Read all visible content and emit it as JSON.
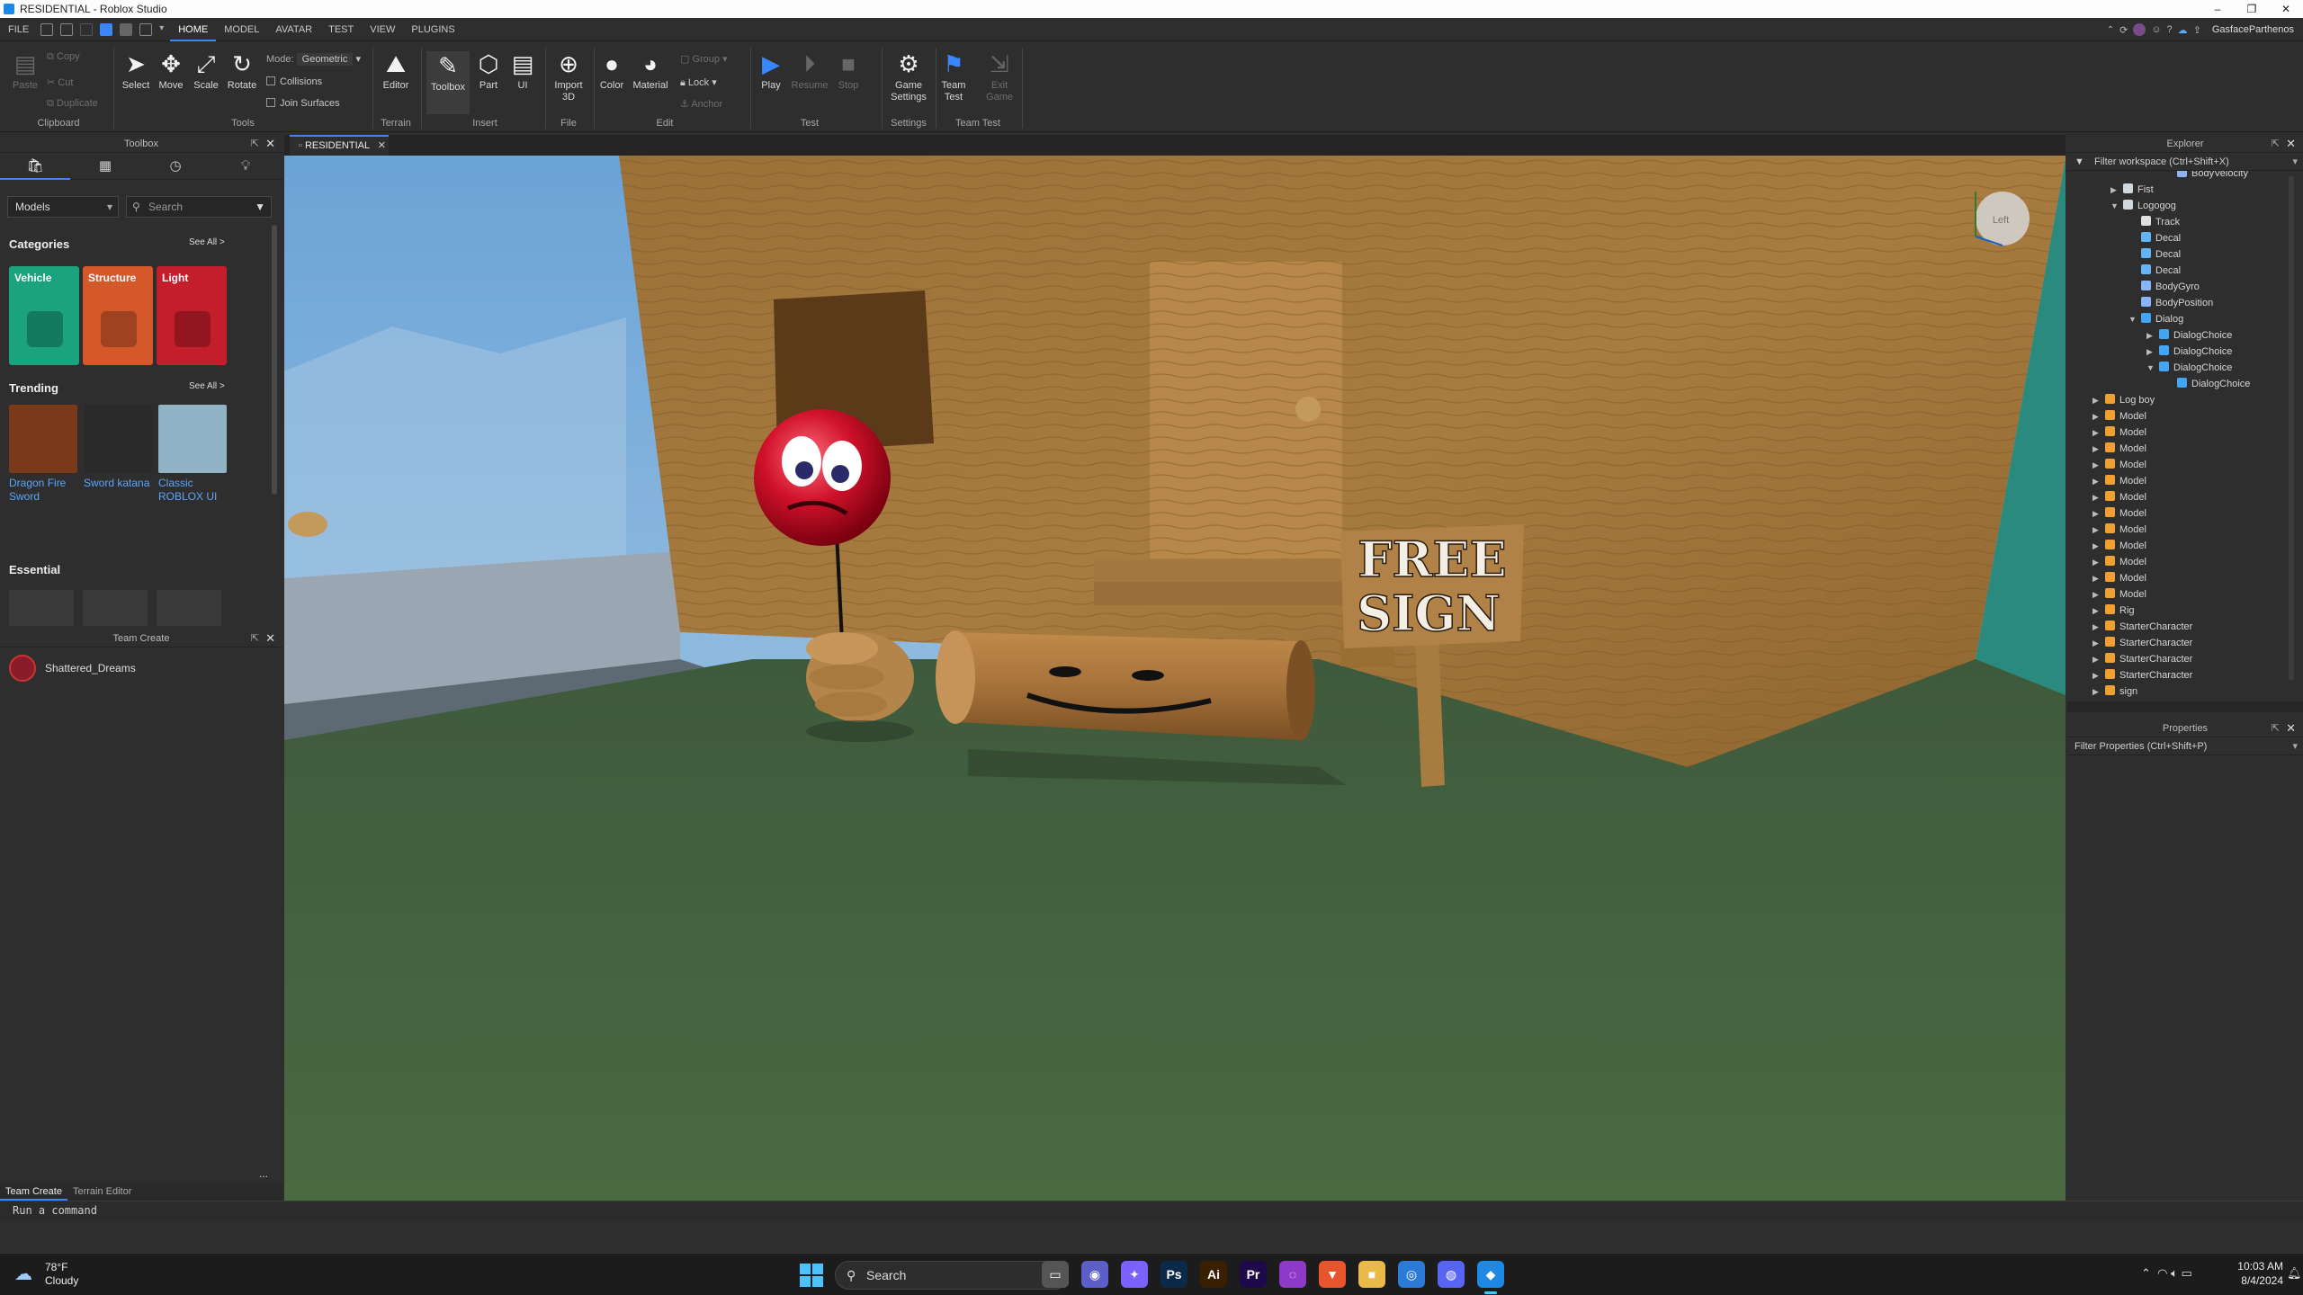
{
  "window": {
    "title": "RESIDENTIAL - Roblox Studio",
    "minimize": "–",
    "maximize": "❐",
    "close": "✕"
  },
  "menu": {
    "items": [
      "FILE",
      "HOME",
      "MODEL",
      "AVATAR",
      "TEST",
      "VIEW",
      "PLUGINS"
    ],
    "active": "HOME",
    "username": "GasfaceParthenos"
  },
  "ribbon": {
    "clipboard": {
      "paste": "Paste",
      "copy": "Copy",
      "cut": "Cut",
      "duplicate": "Duplicate",
      "group": "Clipboard"
    },
    "tools": {
      "select": "Select",
      "move": "Move",
      "scale": "Scale",
      "rotate": "Rotate",
      "mode_label": "Mode:",
      "mode_value": "Geometric",
      "collisions": "Collisions",
      "join_surfaces": "Join Surfaces",
      "group": "Tools"
    },
    "terrain": {
      "editor": "Editor",
      "group": "Terrain"
    },
    "insert": {
      "toolbox": "Toolbox",
      "part": "Part",
      "ui": "UI",
      "group": "Insert"
    },
    "file": {
      "import3d": "Import\n3D",
      "group": "File"
    },
    "edit": {
      "color": "Color",
      "material": "Material",
      "group_btn": "Group",
      "lock": "Lock",
      "anchor": "Anchor",
      "group": "Edit"
    },
    "test": {
      "play": "Play",
      "resume": "Resume",
      "stop": "Stop",
      "group": "Test"
    },
    "settings": {
      "game_settings": "Game\nSettings",
      "group": "Settings"
    },
    "teamtest": {
      "team_test": "Team\nTest",
      "exit_game": "Exit\nGame",
      "group": "Team Test"
    }
  },
  "toolbox": {
    "title": "Toolbox",
    "dropdown": "Models",
    "search_placeholder": "Search",
    "categories_label": "Categories",
    "see_all": "See All >",
    "categories": [
      {
        "name": "Vehicle",
        "color": "#1aa37c"
      },
      {
        "name": "Structure",
        "color": "#d5582a"
      },
      {
        "name": "Light",
        "color": "#c41d2b"
      }
    ],
    "trending_label": "Trending",
    "trending": [
      {
        "name": "Dragon Fire Sword"
      },
      {
        "name": "Sword katana"
      },
      {
        "name": "Classic ROBLOX UI"
      }
    ],
    "essential_label": "Essential"
  },
  "teamcreate": {
    "title": "Team Create",
    "user": "Shattered_Dreams",
    "bottom_tabs": [
      "Team Create",
      "Terrain Editor"
    ],
    "more": "..."
  },
  "viewport": {
    "tab": "RESIDENTIAL",
    "sign_line1": "FREE",
    "sign_line2": "SIGN",
    "viewcube": "Left"
  },
  "explorer": {
    "title": "Explorer",
    "filter": "Filter workspace (Ctrl+Shift+X)",
    "items": [
      {
        "label": "BodyVelocity",
        "indent": 5,
        "arrow": "",
        "color": "#8ab4f8"
      },
      {
        "label": "Fist",
        "indent": 2,
        "arrow": "▶",
        "color": "#cfd8dc"
      },
      {
        "label": "Logogog",
        "indent": 2,
        "arrow": "▼",
        "color": "#cfd8dc"
      },
      {
        "label": "Track",
        "indent": 3,
        "arrow": "",
        "color": "#e0e0e0"
      },
      {
        "label": "Decal",
        "indent": 3,
        "arrow": "",
        "color": "#64b5f6"
      },
      {
        "label": "Decal",
        "indent": 3,
        "arrow": "",
        "color": "#64b5f6"
      },
      {
        "label": "Decal",
        "indent": 3,
        "arrow": "",
        "color": "#64b5f6"
      },
      {
        "label": "BodyGyro",
        "indent": 3,
        "arrow": "",
        "color": "#8ab4f8"
      },
      {
        "label": "BodyPosition",
        "indent": 3,
        "arrow": "",
        "color": "#8ab4f8"
      },
      {
        "label": "Dialog",
        "indent": 3,
        "arrow": "▼",
        "color": "#42a5f5"
      },
      {
        "label": "DialogChoice",
        "indent": 4,
        "arrow": "▶",
        "color": "#42a5f5"
      },
      {
        "label": "DialogChoice",
        "indent": 4,
        "arrow": "▶",
        "color": "#42a5f5"
      },
      {
        "label": "DialogChoice",
        "indent": 4,
        "arrow": "▼",
        "color": "#42a5f5"
      },
      {
        "label": "DialogChoice",
        "indent": 5,
        "arrow": "",
        "color": "#42a5f5"
      },
      {
        "label": "Log boy",
        "indent": 1,
        "arrow": "▶",
        "color": "#f0a030"
      },
      {
        "label": "Model",
        "indent": 1,
        "arrow": "▶",
        "color": "#f0a030"
      },
      {
        "label": "Model",
        "indent": 1,
        "arrow": "▶",
        "color": "#f0a030"
      },
      {
        "label": "Model",
        "indent": 1,
        "arrow": "▶",
        "color": "#f0a030"
      },
      {
        "label": "Model",
        "indent": 1,
        "arrow": "▶",
        "color": "#f0a030"
      },
      {
        "label": "Model",
        "indent": 1,
        "arrow": "▶",
        "color": "#f0a030"
      },
      {
        "label": "Model",
        "indent": 1,
        "arrow": "▶",
        "color": "#f0a030"
      },
      {
        "label": "Model",
        "indent": 1,
        "arrow": "▶",
        "color": "#f0a030"
      },
      {
        "label": "Model",
        "indent": 1,
        "arrow": "▶",
        "color": "#f0a030"
      },
      {
        "label": "Model",
        "indent": 1,
        "arrow": "▶",
        "color": "#f0a030"
      },
      {
        "label": "Model",
        "indent": 1,
        "arrow": "▶",
        "color": "#f0a030"
      },
      {
        "label": "Model",
        "indent": 1,
        "arrow": "▶",
        "color": "#f0a030"
      },
      {
        "label": "Model",
        "indent": 1,
        "arrow": "▶",
        "color": "#f0a030"
      },
      {
        "label": "Rig",
        "indent": 1,
        "arrow": "▶",
        "color": "#f0a030"
      },
      {
        "label": "StarterCharacter",
        "indent": 1,
        "arrow": "▶",
        "color": "#f0a030"
      },
      {
        "label": "StarterCharacter",
        "indent": 1,
        "arrow": "▶",
        "color": "#f0a030"
      },
      {
        "label": "StarterCharacter",
        "indent": 1,
        "arrow": "▶",
        "color": "#f0a030"
      },
      {
        "label": "StarterCharacter",
        "indent": 1,
        "arrow": "▶",
        "color": "#f0a030"
      },
      {
        "label": "sign",
        "indent": 1,
        "arrow": "▶",
        "color": "#f0a030"
      }
    ]
  },
  "properties": {
    "title": "Properties",
    "filter": "Filter Properties (Ctrl+Shift+P)"
  },
  "command": {
    "placeholder": "Run a command"
  },
  "taskbar": {
    "weather_temp": "78°F",
    "weather_desc": "Cloudy",
    "search": "Search",
    "time": "10:03 AM",
    "date": "8/4/2024",
    "apps": [
      {
        "icon": "file-explorer-icon",
        "glyph": "▭",
        "color": "#555"
      },
      {
        "icon": "chat-icon",
        "glyph": "◉",
        "color": "#5b5fc7"
      },
      {
        "icon": "copilot-icon",
        "glyph": "✦",
        "color": "#7b61ff"
      },
      {
        "icon": "photoshop-icon",
        "glyph": "Ps",
        "color": "#0b2a4a"
      },
      {
        "icon": "illustrator-icon",
        "glyph": "Ai",
        "color": "#3a1e00"
      },
      {
        "icon": "premiere-icon",
        "glyph": "Pr",
        "color": "#1e0a4a"
      },
      {
        "icon": "app-purple-icon",
        "glyph": "◌",
        "color": "#8e3ac8"
      },
      {
        "icon": "brave-icon",
        "glyph": "▼",
        "color": "#e8552c"
      },
      {
        "icon": "folder-icon",
        "glyph": "■",
        "color": "#e9b949"
      },
      {
        "icon": "browser-icon",
        "glyph": "◎",
        "color": "#2a7ad6"
      },
      {
        "icon": "discord-icon",
        "glyph": "◍",
        "color": "#5865f2"
      },
      {
        "icon": "roblox-studio-icon",
        "glyph": "◆",
        "color": "#1e88e5"
      }
    ]
  }
}
